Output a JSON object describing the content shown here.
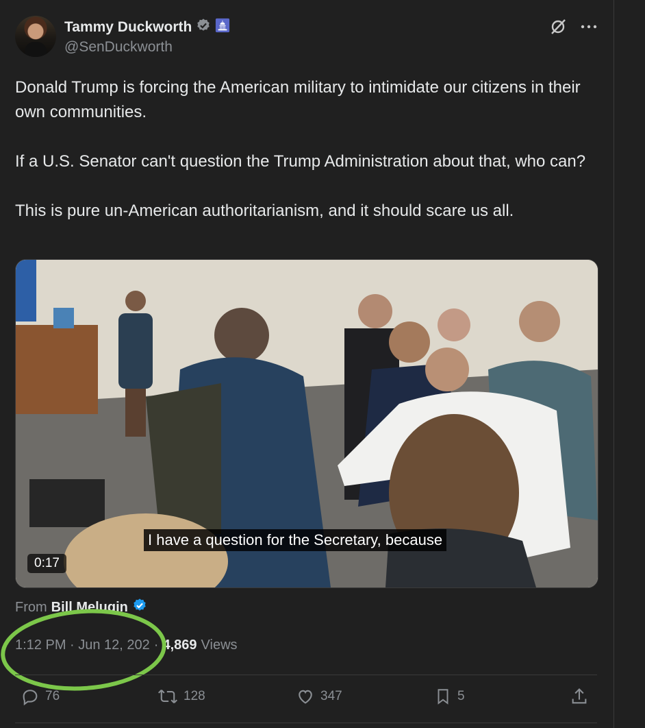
{
  "author": {
    "name": "Tammy Duckworth",
    "handle": "@SenDuckworth"
  },
  "icons": {
    "verified": "verified-badge-icon",
    "capitol": "capitol-building-icon",
    "grok": "grok-icon",
    "more": "more-options-icon"
  },
  "tweet": {
    "paragraphs": [
      "Donald Trump is forcing the American military to intimidate our citizens in their own communities.",
      "If a U.S. Senator can't question the Trump Administration about that, who can?",
      "This is pure un-American authoritarianism, and it should scare us all."
    ]
  },
  "media": {
    "caption": "I have a question for the Secretary, because",
    "duration": "0:17"
  },
  "source": {
    "prefix": "From",
    "name": "Bill Melugin"
  },
  "meta": {
    "timestamp": "1:12 PM · Jun 12, 202",
    "separator": "·",
    "views_count": "4,869",
    "views_label": "Views"
  },
  "actions": {
    "replies": "76",
    "reposts": "128",
    "likes": "347",
    "bookmarks": "5"
  },
  "colors": {
    "background": "#202020",
    "verified": "#1d9bf0",
    "annotation_circle": "#7cc74a"
  }
}
